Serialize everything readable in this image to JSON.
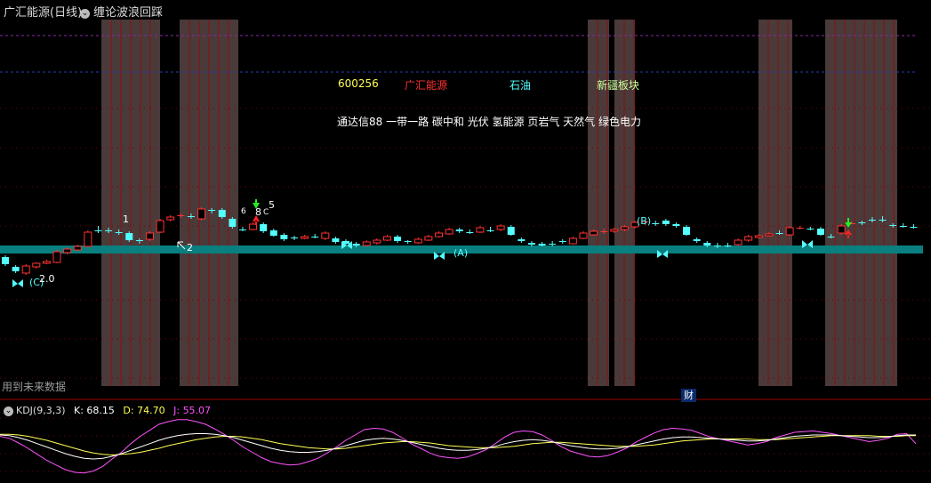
{
  "header": {
    "stock_name": "广汇能源(日线)",
    "indicator_name": "缠论波浪回踩",
    "indicator_icon": "chevron-down-icon"
  },
  "info_labels": {
    "code": "600256",
    "name": "广汇能源",
    "industry": "石油",
    "sector": "新疆板块",
    "concepts": "通达信88 一带一路 碳中和 光伏 氢能源 页岩气 天然气 绿色电力"
  },
  "wave_labels": [
    "1",
    "2",
    "5",
    "(A)",
    "(B)",
    "(C)",
    "6",
    "8",
    "C",
    "2.0"
  ],
  "notice": "用到未来数据",
  "finance_marker": "财",
  "kdj": {
    "name": "KDJ(9,3,3)",
    "k_label": "K:",
    "k_value": "68.15",
    "d_label": "D:",
    "d_value": "74.70",
    "j_label": "J:",
    "j_value": "55.07"
  },
  "colors": {
    "up": "#ff3232",
    "down": "#54ffff",
    "band": "#0a7f7f",
    "shade": "#4a3a3a",
    "code_color": "#ffff54",
    "name_color": "#ff3232",
    "industry_color": "#54ffff",
    "sector_color": "#c8ff9a",
    "k_color": "#ffffff",
    "d_color": "#ffff54",
    "j_color": "#ff54ff"
  },
  "candles": [
    {
      "o": 289,
      "c": 297,
      "h": 287,
      "l": 299
    },
    {
      "o": 300,
      "c": 305,
      "h": 298,
      "l": 307
    },
    {
      "o": 307,
      "c": 299,
      "h": 297,
      "l": 309
    },
    {
      "o": 300,
      "c": 296,
      "h": 295,
      "l": 302
    },
    {
      "o": 296,
      "c": 294,
      "h": 292,
      "l": 297
    },
    {
      "o": 295,
      "c": 283,
      "h": 281,
      "l": 296
    },
    {
      "o": 284,
      "c": 280,
      "h": 278,
      "l": 286
    },
    {
      "o": 281,
      "c": 277,
      "h": 275,
      "l": 282
    },
    {
      "o": 277,
      "c": 261,
      "h": 259,
      "l": 278
    },
    {
      "o": 259,
      "c": 259,
      "h": 254,
      "l": 262
    },
    {
      "o": 259,
      "c": 259,
      "h": 256,
      "l": 262
    },
    {
      "o": 261,
      "c": 261,
      "h": 258,
      "l": 264
    },
    {
      "o": 262,
      "c": 270,
      "h": 260,
      "l": 272
    },
    {
      "o": 270,
      "c": 271,
      "h": 268,
      "l": 274
    },
    {
      "o": 269,
      "c": 262,
      "h": 260,
      "l": 271
    },
    {
      "o": 261,
      "c": 248,
      "h": 246,
      "l": 262
    },
    {
      "o": 247,
      "c": 244,
      "h": 242,
      "l": 249
    },
    {
      "o": 243,
      "c": 242,
      "h": 240,
      "l": 245
    },
    {
      "o": 243,
      "c": 243,
      "h": 240,
      "l": 246
    },
    {
      "o": 246,
      "c": 235,
      "h": 233,
      "l": 248
    },
    {
      "o": 236,
      "c": 236,
      "h": 234,
      "l": 240
    },
    {
      "o": 236,
      "c": 244,
      "h": 234,
      "l": 246
    },
    {
      "o": 246,
      "c": 255,
      "h": 244,
      "l": 257
    },
    {
      "o": 258,
      "c": 258,
      "h": 255,
      "l": 260
    },
    {
      "o": 258,
      "c": 252,
      "h": 250,
      "l": 259
    },
    {
      "o": 252,
      "c": 260,
      "h": 250,
      "l": 262
    },
    {
      "o": 259,
      "c": 265,
      "h": 257,
      "l": 266
    },
    {
      "o": 264,
      "c": 269,
      "h": 262,
      "l": 271
    },
    {
      "o": 267,
      "c": 267,
      "h": 265,
      "l": 270
    },
    {
      "o": 268,
      "c": 266,
      "h": 264,
      "l": 269
    },
    {
      "o": 266,
      "c": 266,
      "h": 263,
      "l": 268
    },
    {
      "o": 268,
      "c": 262,
      "h": 260,
      "l": 270
    },
    {
      "o": 268,
      "c": 272,
      "h": 266,
      "l": 274
    },
    {
      "o": 271,
      "c": 274,
      "h": 269,
      "l": 276
    },
    {
      "o": 274,
      "c": 276,
      "h": 272,
      "l": 278
    },
    {
      "o": 276,
      "c": 272,
      "h": 270,
      "l": 277
    },
    {
      "o": 273,
      "c": 270,
      "h": 268,
      "l": 275
    },
    {
      "o": 270,
      "c": 266,
      "h": 264,
      "l": 271
    },
    {
      "o": 266,
      "c": 271,
      "h": 264,
      "l": 273
    },
    {
      "o": 271,
      "c": 272,
      "h": 270,
      "l": 274
    },
    {
      "o": 273,
      "c": 269,
      "h": 267,
      "l": 274
    },
    {
      "o": 270,
      "c": 266,
      "h": 264,
      "l": 271
    },
    {
      "o": 266,
      "c": 262,
      "h": 260,
      "l": 267
    },
    {
      "o": 263,
      "c": 258,
      "h": 256,
      "l": 264
    },
    {
      "o": 258,
      "c": 260,
      "h": 256,
      "l": 262
    },
    {
      "o": 261,
      "c": 261,
      "h": 258,
      "l": 263
    },
    {
      "o": 261,
      "c": 256,
      "h": 254,
      "l": 262
    },
    {
      "o": 259,
      "c": 259,
      "h": 255,
      "l": 261
    },
    {
      "o": 258,
      "c": 254,
      "h": 252,
      "l": 260
    },
    {
      "o": 255,
      "c": 264,
      "h": 253,
      "l": 265
    },
    {
      "o": 269,
      "c": 271,
      "h": 267,
      "l": 273
    },
    {
      "o": 273,
      "c": 275,
      "h": 271,
      "l": 277
    },
    {
      "o": 274,
      "c": 276,
      "h": 272,
      "l": 277
    },
    {
      "o": 274,
      "c": 274,
      "h": 271,
      "l": 277
    },
    {
      "o": 271,
      "c": 271,
      "h": 269,
      "l": 274
    },
    {
      "o": 274,
      "c": 268,
      "h": 266,
      "l": 275
    },
    {
      "o": 268,
      "c": 262,
      "h": 260,
      "l": 269
    },
    {
      "o": 264,
      "c": 260,
      "h": 258,
      "l": 265
    },
    {
      "o": 261,
      "c": 260,
      "h": 257,
      "l": 263
    },
    {
      "o": 260,
      "c": 258,
      "h": 256,
      "l": 262
    },
    {
      "o": 258,
      "c": 255,
      "h": 253,
      "l": 260
    },
    {
      "o": 255,
      "c": 250,
      "h": 248,
      "l": 257
    },
    {
      "o": 250,
      "c": 249,
      "h": 247,
      "l": 253
    },
    {
      "o": 251,
      "c": 251,
      "h": 248,
      "l": 254
    },
    {
      "o": 248,
      "c": 252,
      "h": 246,
      "l": 254
    },
    {
      "o": 252,
      "c": 254,
      "h": 250,
      "l": 256
    },
    {
      "o": 255,
      "c": 264,
      "h": 253,
      "l": 265
    },
    {
      "o": 269,
      "c": 271,
      "h": 267,
      "l": 273
    },
    {
      "o": 273,
      "c": 276,
      "h": 271,
      "l": 278
    },
    {
      "o": 276,
      "c": 276,
      "h": 273,
      "l": 279
    },
    {
      "o": 276,
      "c": 276,
      "h": 273,
      "l": 278
    },
    {
      "o": 275,
      "c": 270,
      "h": 268,
      "l": 276
    },
    {
      "o": 270,
      "c": 266,
      "h": 264,
      "l": 272
    },
    {
      "o": 267,
      "c": 265,
      "h": 263,
      "l": 268
    },
    {
      "o": 265,
      "c": 263,
      "h": 261,
      "l": 266
    },
    {
      "o": 262,
      "c": 262,
      "h": 259,
      "l": 264
    },
    {
      "o": 264,
      "c": 256,
      "h": 254,
      "l": 265
    },
    {
      "o": 257,
      "c": 256,
      "h": 254,
      "l": 258
    },
    {
      "o": 257,
      "c": 257,
      "h": 255,
      "l": 259
    },
    {
      "o": 257,
      "c": 264,
      "h": 255,
      "l": 265
    },
    {
      "o": 266,
      "c": 266,
      "h": 263,
      "l": 268
    },
    {
      "o": 262,
      "c": 254,
      "h": 252,
      "l": 264
    },
    {
      "o": 252,
      "c": 251,
      "h": 249,
      "l": 252
    },
    {
      "o": 250,
      "c": 250,
      "h": 248,
      "l": 253
    },
    {
      "o": 247,
      "c": 247,
      "h": 244,
      "l": 250
    },
    {
      "o": 247,
      "c": 247,
      "h": 243,
      "l": 250
    },
    {
      "o": 253,
      "c": 253,
      "h": 251,
      "l": 256
    },
    {
      "o": 254,
      "c": 254,
      "h": 251,
      "l": 256
    },
    {
      "o": 255,
      "c": 255,
      "h": 252,
      "l": 257
    }
  ],
  "kdj_series": {
    "k": [
      68,
      67,
      64,
      60,
      55,
      50,
      45,
      40,
      36,
      33,
      32,
      33,
      36,
      40,
      45,
      50,
      55,
      60,
      64,
      67,
      69,
      70,
      70,
      69,
      67,
      64,
      60,
      56,
      52,
      48,
      45,
      43,
      42,
      42,
      43,
      45,
      48,
      52,
      56,
      60,
      62,
      63,
      62,
      60,
      57,
      54,
      51,
      48,
      46,
      45,
      45,
      46,
      48,
      51,
      55,
      58,
      60,
      61,
      60,
      58,
      55,
      52,
      50,
      48,
      47,
      47,
      48,
      50,
      53,
      56,
      59,
      62,
      64,
      65,
      65,
      64,
      63,
      62,
      61,
      60,
      59,
      59,
      60,
      62,
      64,
      66,
      67,
      68,
      68,
      68,
      67,
      66,
      65,
      64,
      64,
      65,
      67,
      68,
      68
    ],
    "d": [
      69,
      69,
      68,
      66,
      63,
      60,
      56,
      52,
      48,
      44,
      41,
      39,
      38,
      39,
      40,
      42,
      45,
      48,
      52,
      55,
      58,
      61,
      63,
      65,
      66,
      66,
      65,
      63,
      61,
      58,
      55,
      53,
      51,
      49,
      48,
      47,
      47,
      48,
      50,
      52,
      54,
      56,
      57,
      58,
      58,
      57,
      56,
      54,
      52,
      51,
      50,
      49,
      49,
      49,
      50,
      51,
      53,
      55,
      56,
      57,
      57,
      56,
      55,
      54,
      53,
      52,
      51,
      51,
      51,
      52,
      53,
      55,
      57,
      59,
      60,
      61,
      62,
      62,
      62,
      62,
      62,
      61,
      61,
      61,
      62,
      63,
      64,
      65,
      66,
      67,
      67,
      67,
      67,
      67,
      66,
      66,
      66,
      67,
      67
    ],
    "j": [
      66,
      63,
      56,
      48,
      39,
      30,
      23,
      16,
      12,
      11,
      14,
      21,
      32,
      42,
      55,
      66,
      75,
      84,
      88,
      91,
      91,
      88,
      84,
      77,
      69,
      60,
      50,
      42,
      34,
      28,
      25,
      23,
      24,
      28,
      33,
      41,
      50,
      60,
      68,
      76,
      78,
      77,
      72,
      64,
      55,
      48,
      41,
      36,
      34,
      33,
      35,
      40,
      46,
      55,
      65,
      72,
      74,
      73,
      68,
      60,
      51,
      44,
      40,
      36,
      35,
      37,
      42,
      48,
      57,
      64,
      71,
      76,
      78,
      77,
      75,
      70,
      65,
      62,
      59,
      56,
      53,
      55,
      58,
      64,
      68,
      72,
      73,
      74,
      72,
      70,
      67,
      64,
      61,
      58,
      60,
      63,
      69,
      70,
      55
    ]
  }
}
